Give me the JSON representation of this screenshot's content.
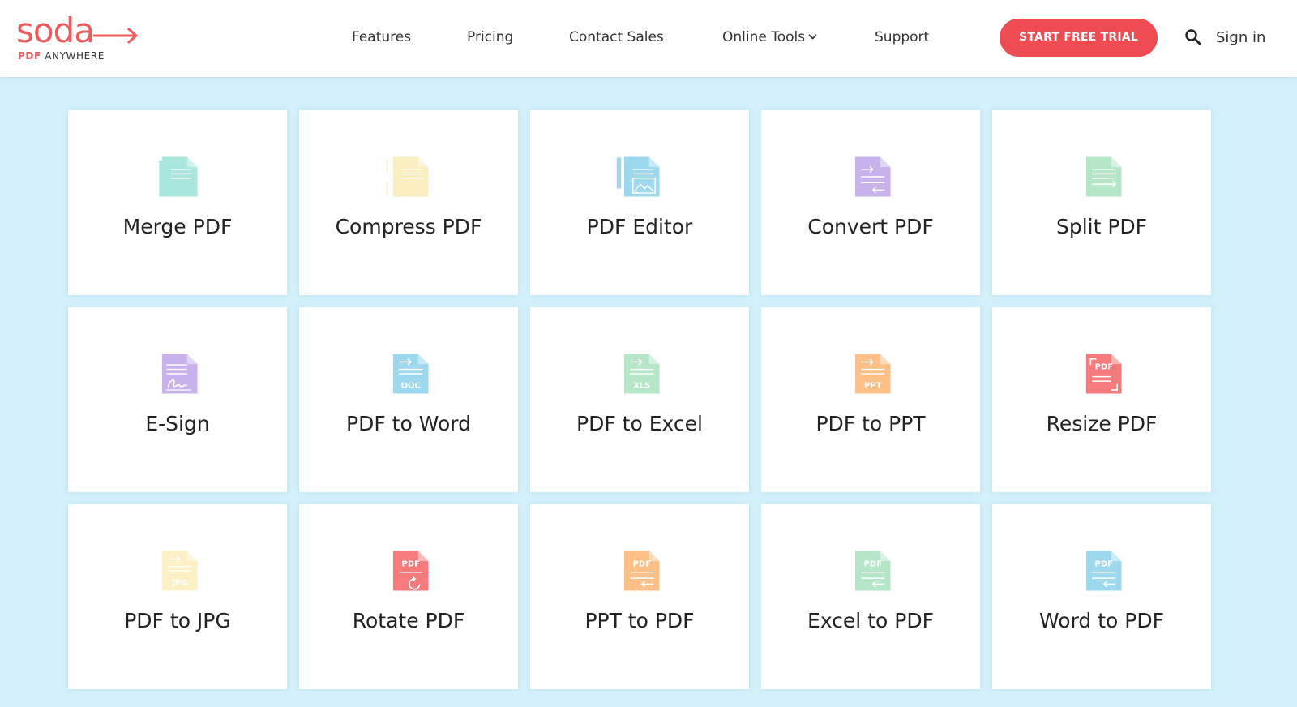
{
  "header": {
    "logo": {
      "word": "soda",
      "sub_pdf": "PDF",
      "sub_anywhere": "ANYWHERE"
    },
    "nav": [
      {
        "label": "Features"
      },
      {
        "label": "Pricing"
      },
      {
        "label": "Contact Sales"
      },
      {
        "label": "Online Tools",
        "has_dropdown": true
      },
      {
        "label": "Support"
      }
    ],
    "cta_label": "START FREE TRIAL",
    "search_icon": "search-icon",
    "signin_label": "Sign in"
  },
  "colors": {
    "brand_red": "#ef4b52",
    "page_bg": "#d3f0fb",
    "teal": "#a8e6de",
    "yellow": "#fbeec0",
    "blue": "#9ed8ee",
    "purple": "#c7b2ec",
    "green": "#b5e6c8",
    "orange": "#ffc088",
    "red": "#f57a7c",
    "pale_yellow": "#fcf0c4"
  },
  "tools": [
    {
      "label": "Merge PDF",
      "icon": "merge-icon",
      "color": "#a8e6de",
      "badge": ""
    },
    {
      "label": "Compress PDF",
      "icon": "compress-icon",
      "color": "#fbeec0",
      "badge": ""
    },
    {
      "label": "PDF Editor",
      "icon": "editor-icon",
      "color": "#9ed8ee",
      "badge": ""
    },
    {
      "label": "Convert PDF",
      "icon": "convert-icon",
      "color": "#c7b2ec",
      "badge": ""
    },
    {
      "label": "Split PDF",
      "icon": "split-icon",
      "color": "#b5e6c8",
      "badge": ""
    },
    {
      "label": "E-Sign",
      "icon": "esign-icon",
      "color": "#c7b2ec",
      "badge": ""
    },
    {
      "label": "PDF to Word",
      "icon": "pdf-to-word-icon",
      "color": "#9ed8ee",
      "badge": "DOC"
    },
    {
      "label": "PDF to Excel",
      "icon": "pdf-to-excel-icon",
      "color": "#b5e6c8",
      "badge": "XLS"
    },
    {
      "label": "PDF to PPT",
      "icon": "pdf-to-ppt-icon",
      "color": "#ffc088",
      "badge": "PPT"
    },
    {
      "label": "Resize PDF",
      "icon": "resize-icon",
      "color": "#f57a7c",
      "badge": "PDF"
    },
    {
      "label": "PDF to JPG",
      "icon": "pdf-to-jpg-icon",
      "color": "#fcf0c4",
      "badge": "JPG"
    },
    {
      "label": "Rotate PDF",
      "icon": "rotate-icon",
      "color": "#f57a7c",
      "badge": "PDF"
    },
    {
      "label": "PPT to PDF",
      "icon": "ppt-to-pdf-icon",
      "color": "#ffc088",
      "badge": "PDF"
    },
    {
      "label": "Excel to PDF",
      "icon": "excel-to-pdf-icon",
      "color": "#b5e6c8",
      "badge": "PDF"
    },
    {
      "label": "Word to PDF",
      "icon": "word-to-pdf-icon",
      "color": "#9ed8ee",
      "badge": "PDF"
    }
  ]
}
